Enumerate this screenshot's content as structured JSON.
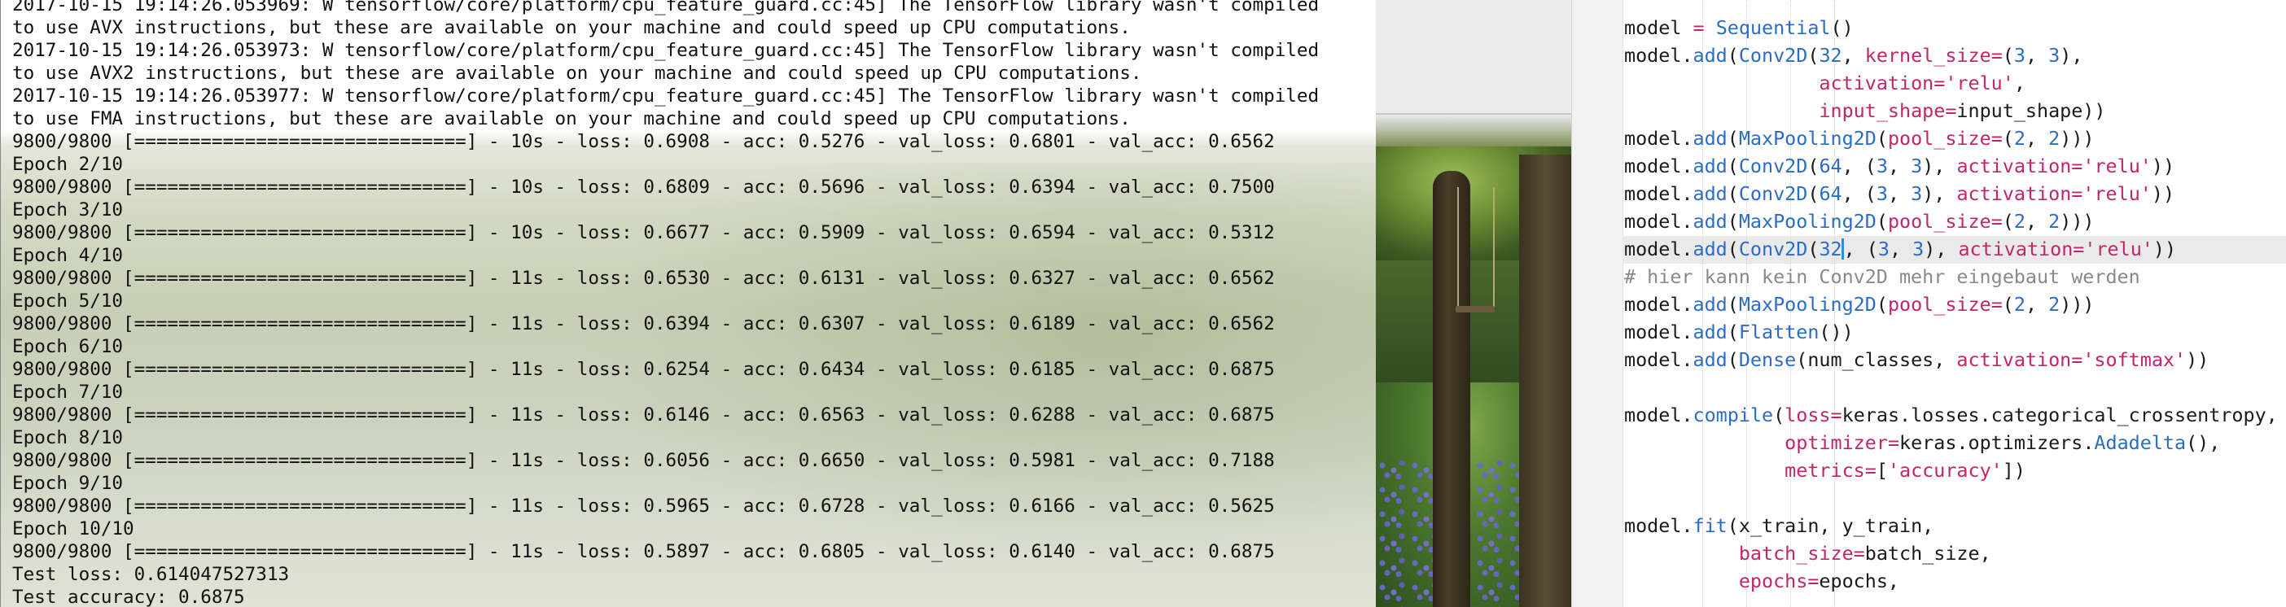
{
  "terminal": {
    "lines": [
      "2017-10-15 19:14:26.053969: W tensorflow/core/platform/cpu_feature_guard.cc:45] The TensorFlow library wasn't compiled",
      "to use AVX instructions, but these are available on your machine and could speed up CPU computations.",
      "2017-10-15 19:14:26.053973: W tensorflow/core/platform/cpu_feature_guard.cc:45] The TensorFlow library wasn't compiled",
      "to use AVX2 instructions, but these are available on your machine and could speed up CPU computations.",
      "2017-10-15 19:14:26.053977: W tensorflow/core/platform/cpu_feature_guard.cc:45] The TensorFlow library wasn't compiled",
      "to use FMA instructions, but these are available on your machine and could speed up CPU computations.",
      "9800/9800 [==============================] - 10s - loss: 0.6908 - acc: 0.5276 - val_loss: 0.6801 - val_acc: 0.6562",
      "Epoch 2/10",
      "9800/9800 [==============================] - 10s - loss: 0.6809 - acc: 0.5696 - val_loss: 0.6394 - val_acc: 0.7500",
      "Epoch 3/10",
      "9800/9800 [==============================] - 10s - loss: 0.6677 - acc: 0.5909 - val_loss: 0.6594 - val_acc: 0.5312",
      "Epoch 4/10",
      "9800/9800 [==============================] - 11s - loss: 0.6530 - acc: 0.6131 - val_loss: 0.6327 - val_acc: 0.6562",
      "Epoch 5/10",
      "9800/9800 [==============================] - 11s - loss: 0.6394 - acc: 0.6307 - val_loss: 0.6189 - val_acc: 0.6562",
      "Epoch 6/10",
      "9800/9800 [==============================] - 11s - loss: 0.6254 - acc: 0.6434 - val_loss: 0.6185 - val_acc: 0.6875",
      "Epoch 7/10",
      "9800/9800 [==============================] - 11s - loss: 0.6146 - acc: 0.6563 - val_loss: 0.6288 - val_acc: 0.6875",
      "Epoch 8/10",
      "9800/9800 [==============================] - 11s - loss: 0.6056 - acc: 0.6650 - val_loss: 0.5981 - val_acc: 0.7188",
      "Epoch 9/10",
      "9800/9800 [==============================] - 11s - loss: 0.5965 - acc: 0.6728 - val_loss: 0.6166 - val_acc: 0.5625",
      "Epoch 10/10",
      "9800/9800 [==============================] - 11s - loss: 0.5897 - acc: 0.6805 - val_loss: 0.6140 - val_acc: 0.6875",
      "Test loss: 0.614047527313",
      "Test accuracy: 0.6875"
    ]
  },
  "editor": {
    "code_lines": [
      [
        [
          "plain",
          "model "
        ],
        [
          "op",
          "="
        ],
        [
          "plain",
          " "
        ],
        [
          "kw",
          "Sequential"
        ],
        [
          "plain",
          "()"
        ]
      ],
      [
        [
          "plain",
          "model."
        ],
        [
          "kw",
          "add"
        ],
        [
          "plain",
          "("
        ],
        [
          "kw",
          "Conv2D"
        ],
        [
          "plain",
          "("
        ],
        [
          "num",
          "32"
        ],
        [
          "plain",
          ", "
        ],
        [
          "param",
          "kernel_size"
        ],
        [
          "op",
          "="
        ],
        [
          "plain",
          "("
        ],
        [
          "num",
          "3"
        ],
        [
          "plain",
          ", "
        ],
        [
          "num",
          "3"
        ],
        [
          "plain",
          "),"
        ]
      ],
      [
        [
          "plain",
          "                 "
        ],
        [
          "param",
          "activation"
        ],
        [
          "op",
          "="
        ],
        [
          "str",
          "'relu'"
        ],
        [
          "plain",
          ","
        ]
      ],
      [
        [
          "plain",
          "                 "
        ],
        [
          "param",
          "input_shape"
        ],
        [
          "op",
          "="
        ],
        [
          "plain",
          "input_shape))"
        ]
      ],
      [
        [
          "plain",
          "model."
        ],
        [
          "kw",
          "add"
        ],
        [
          "plain",
          "("
        ],
        [
          "kw",
          "MaxPooling2D"
        ],
        [
          "plain",
          "("
        ],
        [
          "param",
          "pool_size"
        ],
        [
          "op",
          "="
        ],
        [
          "plain",
          "("
        ],
        [
          "num",
          "2"
        ],
        [
          "plain",
          ", "
        ],
        [
          "num",
          "2"
        ],
        [
          "plain",
          ")))"
        ]
      ],
      [
        [
          "plain",
          "model."
        ],
        [
          "kw",
          "add"
        ],
        [
          "plain",
          "("
        ],
        [
          "kw",
          "Conv2D"
        ],
        [
          "plain",
          "("
        ],
        [
          "num",
          "64"
        ],
        [
          "plain",
          ", ("
        ],
        [
          "num",
          "3"
        ],
        [
          "plain",
          ", "
        ],
        [
          "num",
          "3"
        ],
        [
          "plain",
          "), "
        ],
        [
          "param",
          "activation"
        ],
        [
          "op",
          "="
        ],
        [
          "str",
          "'relu'"
        ],
        [
          "plain",
          "))"
        ]
      ],
      [
        [
          "plain",
          "model."
        ],
        [
          "kw",
          "add"
        ],
        [
          "plain",
          "("
        ],
        [
          "kw",
          "Conv2D"
        ],
        [
          "plain",
          "("
        ],
        [
          "num",
          "64"
        ],
        [
          "plain",
          ", ("
        ],
        [
          "num",
          "3"
        ],
        [
          "plain",
          ", "
        ],
        [
          "num",
          "3"
        ],
        [
          "plain",
          "), "
        ],
        [
          "param",
          "activation"
        ],
        [
          "op",
          "="
        ],
        [
          "str",
          "'relu'"
        ],
        [
          "plain",
          "))"
        ]
      ],
      [
        [
          "plain",
          "model."
        ],
        [
          "kw",
          "add"
        ],
        [
          "plain",
          "("
        ],
        [
          "kw",
          "MaxPooling2D"
        ],
        [
          "plain",
          "("
        ],
        [
          "param",
          "pool_size"
        ],
        [
          "op",
          "="
        ],
        [
          "plain",
          "("
        ],
        [
          "num",
          "2"
        ],
        [
          "plain",
          ", "
        ],
        [
          "num",
          "2"
        ],
        [
          "plain",
          ")))"
        ]
      ],
      [
        [
          "plain",
          "model."
        ],
        [
          "kw",
          "add"
        ],
        [
          "plain",
          "("
        ],
        [
          "kw",
          "Conv2D"
        ],
        [
          "plain",
          "("
        ],
        [
          "num",
          "32"
        ],
        [
          "caret",
          ""
        ],
        [
          "plain",
          ", ("
        ],
        [
          "num",
          "3"
        ],
        [
          "plain",
          ", "
        ],
        [
          "num",
          "3"
        ],
        [
          "plain",
          "), "
        ],
        [
          "param",
          "activation"
        ],
        [
          "op",
          "="
        ],
        [
          "str",
          "'relu'"
        ],
        [
          "plain",
          "))"
        ]
      ],
      [
        [
          "cmt",
          "# hier kann kein Conv2D mehr eingebaut werden"
        ]
      ],
      [
        [
          "plain",
          "model."
        ],
        [
          "kw",
          "add"
        ],
        [
          "plain",
          "("
        ],
        [
          "kw",
          "MaxPooling2D"
        ],
        [
          "plain",
          "("
        ],
        [
          "param",
          "pool_size"
        ],
        [
          "op",
          "="
        ],
        [
          "plain",
          "("
        ],
        [
          "num",
          "2"
        ],
        [
          "plain",
          ", "
        ],
        [
          "num",
          "2"
        ],
        [
          "plain",
          ")))"
        ]
      ],
      [
        [
          "plain",
          "model."
        ],
        [
          "kw",
          "add"
        ],
        [
          "plain",
          "("
        ],
        [
          "kw",
          "Flatten"
        ],
        [
          "plain",
          "())"
        ]
      ],
      [
        [
          "plain",
          "model."
        ],
        [
          "kw",
          "add"
        ],
        [
          "plain",
          "("
        ],
        [
          "kw",
          "Dense"
        ],
        [
          "plain",
          "(num_classes, "
        ],
        [
          "param",
          "activation"
        ],
        [
          "op",
          "="
        ],
        [
          "str",
          "'softmax'"
        ],
        [
          "plain",
          "))"
        ]
      ],
      [
        [
          "plain",
          ""
        ]
      ],
      [
        [
          "plain",
          "model."
        ],
        [
          "kw",
          "compile"
        ],
        [
          "plain",
          "("
        ],
        [
          "param",
          "loss"
        ],
        [
          "op",
          "="
        ],
        [
          "plain",
          "keras.losses.categorical_crossentropy,"
        ]
      ],
      [
        [
          "plain",
          "              "
        ],
        [
          "param",
          "optimizer"
        ],
        [
          "op",
          "="
        ],
        [
          "plain",
          "keras.optimizers."
        ],
        [
          "kw",
          "Adadelta"
        ],
        [
          "plain",
          "(),"
        ]
      ],
      [
        [
          "plain",
          "              "
        ],
        [
          "param",
          "metrics"
        ],
        [
          "op",
          "="
        ],
        [
          "plain",
          "["
        ],
        [
          "str",
          "'accuracy'"
        ],
        [
          "plain",
          "])"
        ]
      ],
      [
        [
          "plain",
          ""
        ]
      ],
      [
        [
          "plain",
          "model."
        ],
        [
          "kw",
          "fit"
        ],
        [
          "plain",
          "(x_train, y_train,"
        ]
      ],
      [
        [
          "plain",
          "          "
        ],
        [
          "param",
          "batch_size"
        ],
        [
          "op",
          "="
        ],
        [
          "plain",
          "batch_size,"
        ]
      ],
      [
        [
          "plain",
          "          "
        ],
        [
          "param",
          "epochs"
        ],
        [
          "op",
          "="
        ],
        [
          "plain",
          "epochs,"
        ]
      ]
    ]
  },
  "colors": {
    "keyword": "#2b6cc4",
    "param": "#c0266e",
    "comment": "#8a8a8a",
    "caret": "#2a8fd6"
  }
}
